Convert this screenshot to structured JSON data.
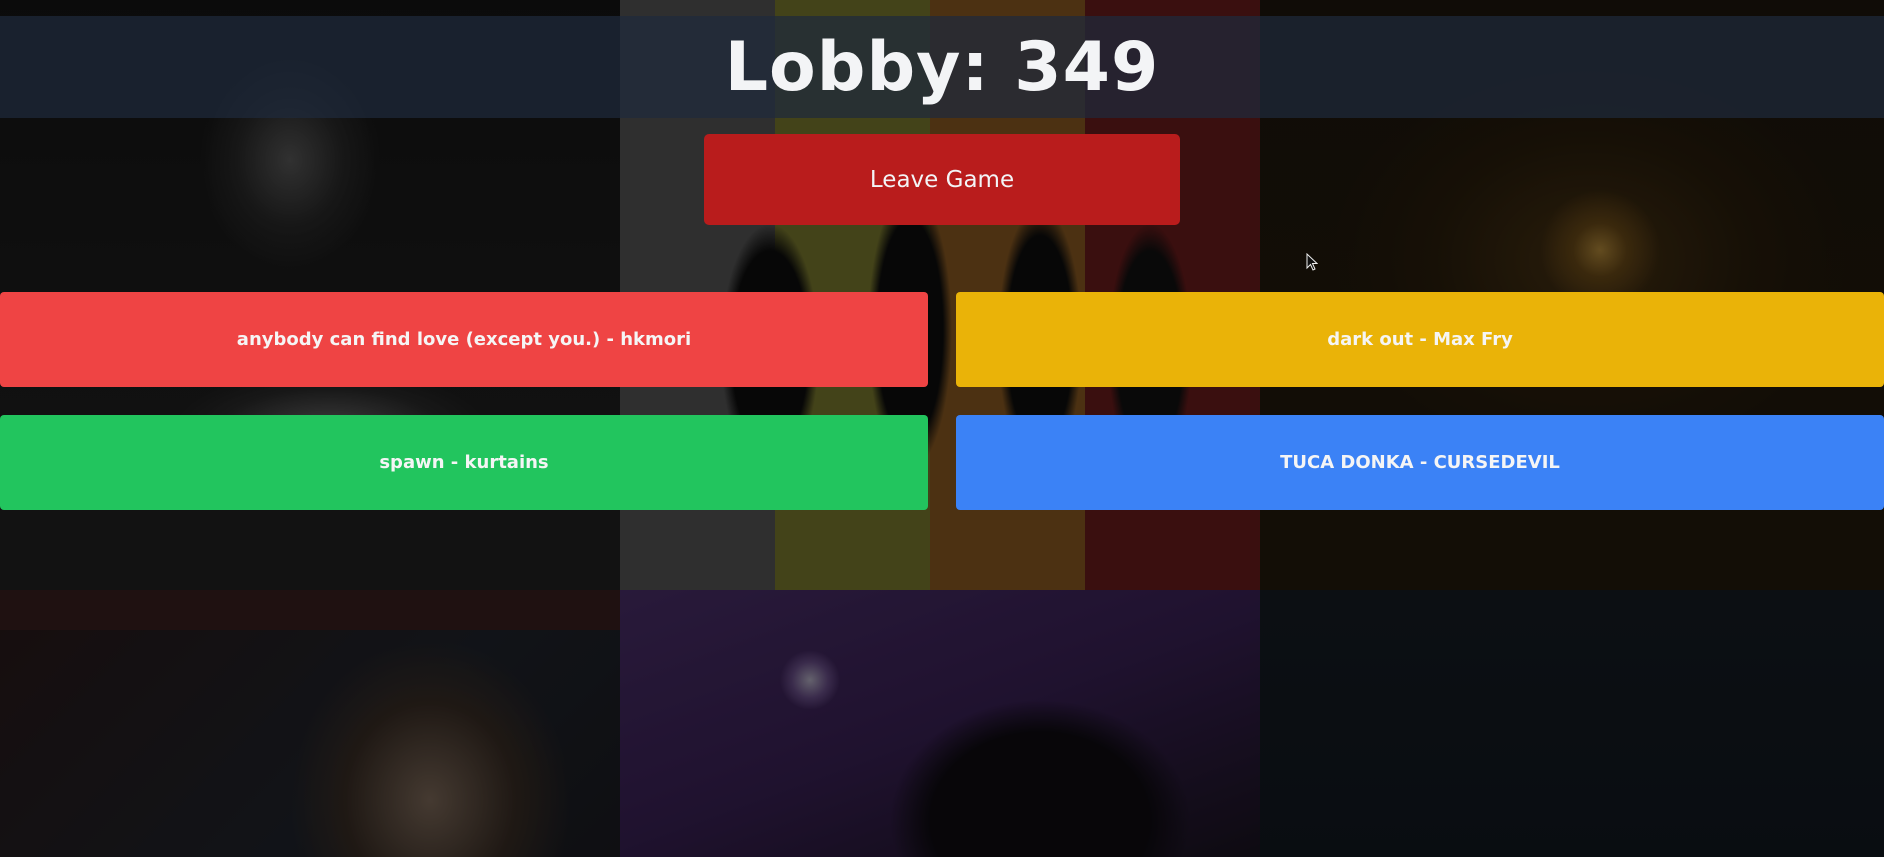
{
  "header": {
    "title": "Lobby: 349"
  },
  "controls": {
    "leave_label": "Leave Game"
  },
  "options": [
    {
      "label": "anybody can find love (except you.) - hkmori",
      "color": "#ef4444"
    },
    {
      "label": "dark out - Max Fry",
      "color": "#eab308"
    },
    {
      "label": "spawn - kurtains",
      "color": "#22c55e"
    },
    {
      "label": "TUCA DONKA - CURSEDEVIL",
      "color": "#3b82f6"
    }
  ],
  "colors": {
    "header_bg": "#1e293b",
    "leave_button": "#b91c1c",
    "text": "#f3f4f6"
  }
}
